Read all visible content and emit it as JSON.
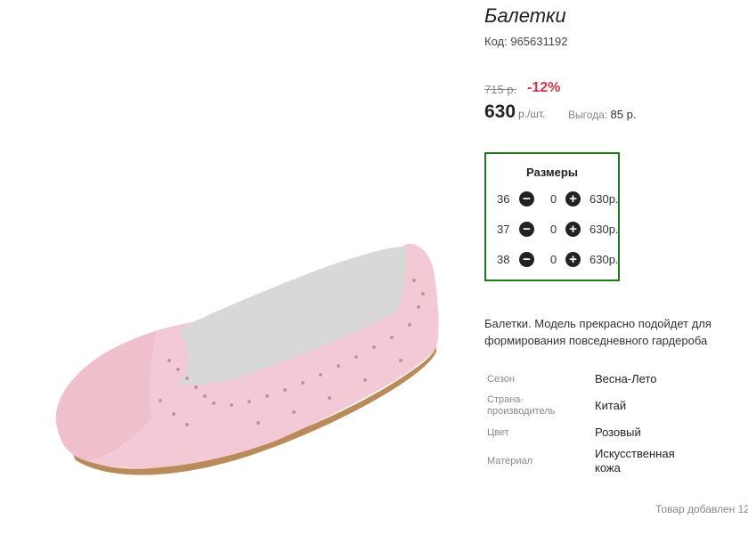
{
  "product": {
    "title": "Балетки",
    "code_label": "Код:",
    "code": "965631192"
  },
  "price": {
    "old": "715 р.",
    "discount": "-12%",
    "current": "630",
    "unit": "р./шт.",
    "benefit_label": "Выгода:",
    "benefit_value": "85 р."
  },
  "sizes": {
    "title": "Размеры",
    "rows": [
      {
        "size": "36",
        "qty": "0",
        "price": "630р."
      },
      {
        "size": "37",
        "qty": "0",
        "price": "630р."
      },
      {
        "size": "38",
        "qty": "0",
        "price": "630р."
      }
    ],
    "minus_icon": "minus-circle-icon",
    "plus_icon": "plus-circle-icon",
    "border_color": "#1a7a1a"
  },
  "description": "Балетки. Модель прекрасно подойдет для формирования повседневного гардероба",
  "attributes": [
    {
      "label": "Сезон",
      "value": "Весна-Лето"
    },
    {
      "label": "Страна-производитель",
      "value": "Китай"
    },
    {
      "label": "Цвет",
      "value": "Розовый"
    },
    {
      "label": "Материал",
      "value": "Искусственная кожа"
    }
  ],
  "footer": {
    "added": "Товар добавлен 12"
  },
  "colors": {
    "discount": "#e0314b",
    "shoe": "#f2c9d4"
  }
}
